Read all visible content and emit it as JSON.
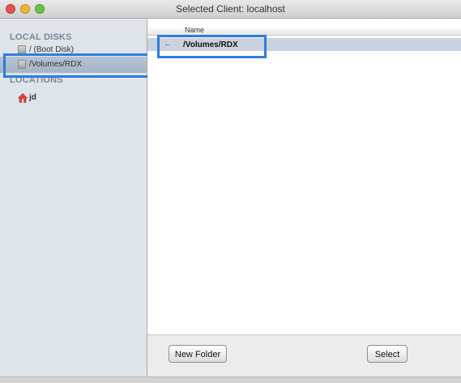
{
  "window": {
    "title": "Selected Client: localhost"
  },
  "sidebar": {
    "local_disks_header": "LOCAL DISKS",
    "disks": [
      {
        "label": "/ (Boot Disk)",
        "icon": "disk-icon"
      },
      {
        "label": "/Volumes/RDX",
        "icon": "disk-icon",
        "selected": true
      }
    ],
    "locations_header": "LOCATIONS",
    "locations": [
      {
        "label": "jd",
        "icon": "home-icon"
      }
    ]
  },
  "file_list": {
    "column_name": "Name",
    "rows": [
      {
        "arrow": "←",
        "path": "/Volumes/RDX",
        "selected": true
      }
    ]
  },
  "buttons": {
    "new_folder": "New Folder",
    "select": "Select"
  },
  "colors": {
    "highlight": "#2d7de0",
    "selected_row": "#c9d2de",
    "sidebar_bg": "#dfe4ea"
  }
}
